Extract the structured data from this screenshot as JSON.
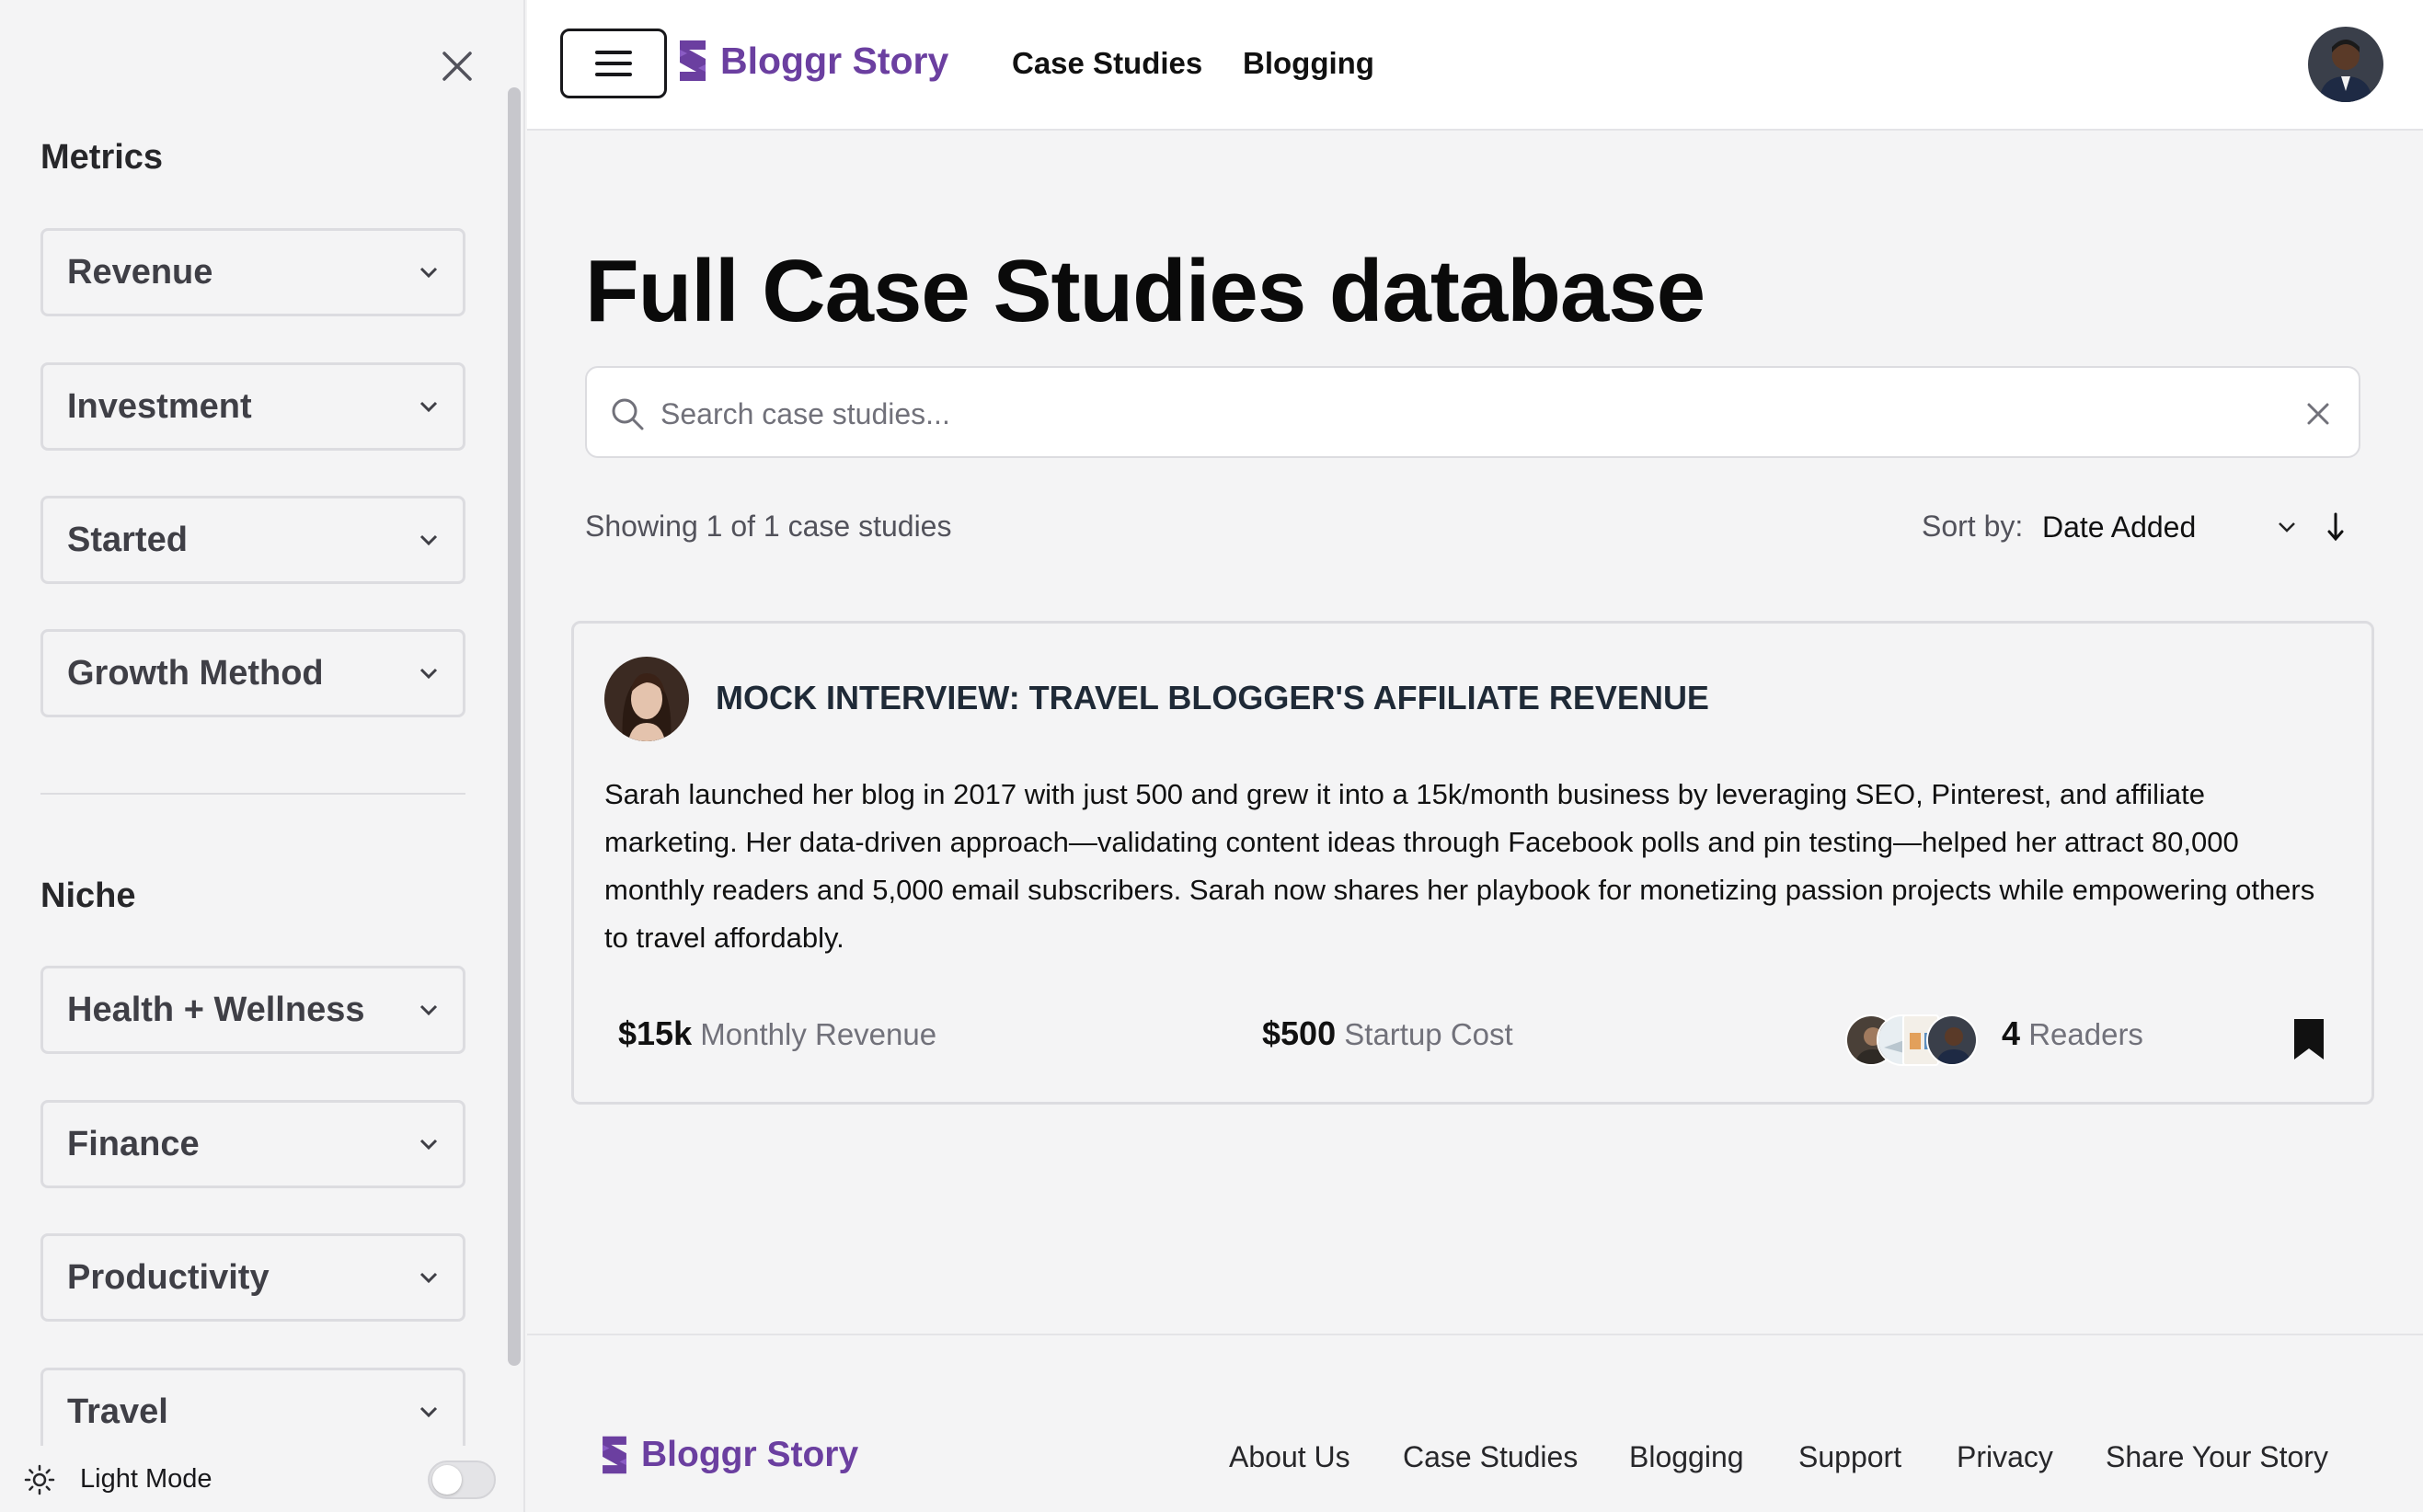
{
  "sidebar": {
    "metrics_title": "Metrics",
    "metrics": [
      {
        "label": "Revenue"
      },
      {
        "label": "Investment"
      },
      {
        "label": "Started"
      },
      {
        "label": "Growth Method"
      }
    ],
    "niche_title": "Niche",
    "niches": [
      {
        "label": "Health + Wellness"
      },
      {
        "label": "Finance"
      },
      {
        "label": "Productivity"
      },
      {
        "label": "Travel"
      }
    ],
    "light_mode_label": "Light Mode",
    "light_mode_on": false
  },
  "header": {
    "brand": "Bloggr Story",
    "nav": [
      "Case Studies",
      "Blogging"
    ]
  },
  "main": {
    "title": "Full Case Studies database",
    "search": {
      "placeholder": "Search case studies...",
      "value": ""
    },
    "results_count": "Showing 1 of 1 case studies",
    "sort_label": "Sort by:",
    "sort_value": "Date Added"
  },
  "card": {
    "title": "MOCK INTERVIEW: TRAVEL BLOGGER'S AFFILIATE REVENUE",
    "description": "Sarah launched her blog in 2017 with just 500 and grew it into a 15k/month business by leveraging SEO, Pinterest, and affiliate marketing. Her data-driven approach—validating content ideas through Facebook polls and pin testing—helped her attract 80,000 monthly readers and 5,000 email subscribers. Sarah now shares her playbook for monetizing passion projects while empowering others to travel affordably.",
    "revenue_value": "$15k",
    "revenue_label": "Monthly Revenue",
    "cost_value": "$500",
    "cost_label": "Startup Cost",
    "readers_value": "4",
    "readers_label": "Readers"
  },
  "footer": {
    "brand": "Bloggr Story",
    "links": [
      "About Us",
      "Case Studies",
      "Blogging",
      "Support",
      "Privacy",
      "Share Your Story"
    ]
  },
  "colors": {
    "brand": "#6b3fa0",
    "background": "#f4f4f5"
  },
  "icons": [
    "close-icon",
    "chevron-down-icon",
    "sun-icon",
    "menu-icon",
    "logo-s-icon",
    "search-icon",
    "clear-icon",
    "sort-direction-icon",
    "bookmark-icon"
  ]
}
